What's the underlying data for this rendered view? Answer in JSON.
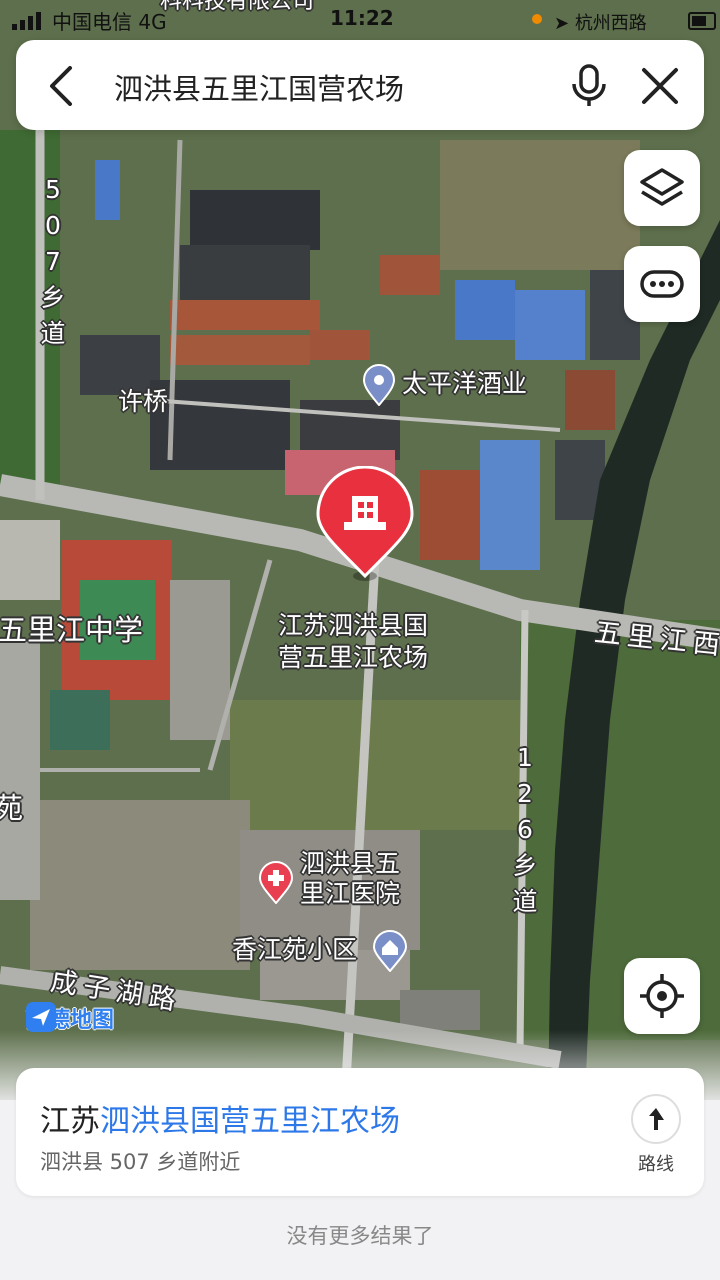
{
  "status_bar": {
    "carrier": "中国电信 4G",
    "time": "11:22",
    "location_text": "杭州西路"
  },
  "search": {
    "query": "泗洪县五里江国营农场",
    "back_icon": "chevron-left-icon",
    "mic_icon": "microphone-icon",
    "close_icon": "close-icon"
  },
  "map": {
    "buttons": [
      "layers-icon",
      "more-icon",
      "locate-icon"
    ],
    "labels": {
      "road_507": "507乡道",
      "xuqiao": "许桥",
      "taipingyang": "太平洋酒业",
      "wulijiang_school": "五里江中学",
      "farm_line1": "江苏泗洪县国",
      "farm_line2": "营五里江农场",
      "wulijiang_road": "五里江西",
      "road_126": "126乡道",
      "hospital_line1": "泗洪县五",
      "hospital_line2": "里江医院",
      "xiangjiangyuan": "香江苑小区",
      "chengzihu_road": "成子湖路",
      "left_edge": "苑",
      "top_cut": "科科技有限公司"
    },
    "logo_text": "高德地图",
    "colors": {
      "pin": "#e8303f",
      "hospital": "#e84050",
      "poi": "#7a8ec8"
    }
  },
  "result": {
    "title_prefix": "江苏",
    "title_highlight": "泗洪县国营五里江农场",
    "address": "泗洪县 507 乡道附近",
    "route_label": "路线",
    "accent": "#2d78e8"
  },
  "footer": {
    "no_more": "没有更多结果了"
  }
}
